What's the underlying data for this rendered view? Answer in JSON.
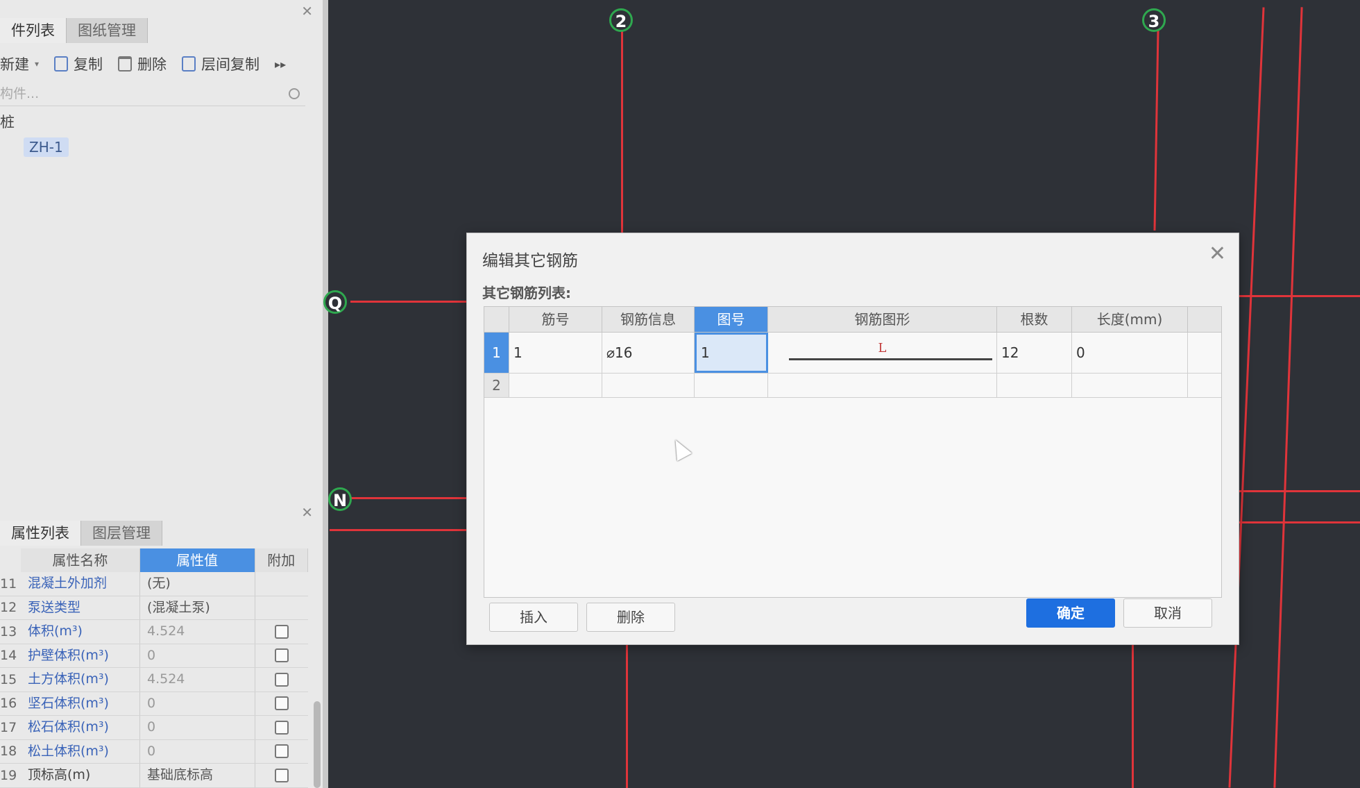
{
  "top_panel": {
    "tabs": [
      "件列表",
      "图纸管理"
    ],
    "toolbar": {
      "new_label": "新建",
      "copy_label": "复制",
      "delete_label": "删除",
      "floor_copy_label": "层间复制"
    },
    "search_placeholder": "构件...",
    "tree": {
      "root": "桩",
      "leaf": "ZH-1"
    }
  },
  "bottom_panel": {
    "tabs": [
      "属性列表",
      "图层管理"
    ],
    "columns": [
      "属性名称",
      "属性值",
      "附加"
    ],
    "rows": [
      {
        "num": "11",
        "name": "混凝土外加剂",
        "value": "(无)",
        "checkbox": false
      },
      {
        "num": "12",
        "name": "泵送类型",
        "value": "(混凝土泵)",
        "checkbox": false
      },
      {
        "num": "13",
        "name": "体积(m³)",
        "value": "4.524",
        "checkbox": true
      },
      {
        "num": "14",
        "name": "护壁体积(m³)",
        "value": "0",
        "checkbox": true
      },
      {
        "num": "15",
        "name": "土方体积(m³)",
        "value": "4.524",
        "checkbox": true
      },
      {
        "num": "16",
        "name": "坚石体积(m³)",
        "value": "0",
        "checkbox": true
      },
      {
        "num": "17",
        "name": "松石体积(m³)",
        "value": "0",
        "checkbox": true
      },
      {
        "num": "18",
        "name": "松土体积(m³)",
        "value": "0",
        "checkbox": true
      },
      {
        "num": "19",
        "name": "顶标高(m)",
        "value": "基础底标高",
        "checkbox": true
      }
    ]
  },
  "canvas": {
    "axis_labels": {
      "a2": "2",
      "a3": "3",
      "aQ": "Q",
      "aN": "N"
    }
  },
  "dialog": {
    "title": "编辑其它钢筋",
    "section_label": "其它钢筋列表:",
    "columns": [
      "筋号",
      "钢筋信息",
      "图号",
      "钢筋图形",
      "根数",
      "长度(mm)"
    ],
    "rows": [
      {
        "rn": "1",
        "bar_no": "1",
        "info": "⌀16",
        "fig_no": "1",
        "shape_text": "L",
        "count": "12",
        "length": "0"
      },
      {
        "rn": "2",
        "bar_no": "",
        "info": "",
        "fig_no": "",
        "shape_text": "",
        "count": "",
        "length": ""
      }
    ],
    "buttons": {
      "insert": "插入",
      "delete": "删除",
      "ok": "确定",
      "cancel": "取消"
    }
  }
}
